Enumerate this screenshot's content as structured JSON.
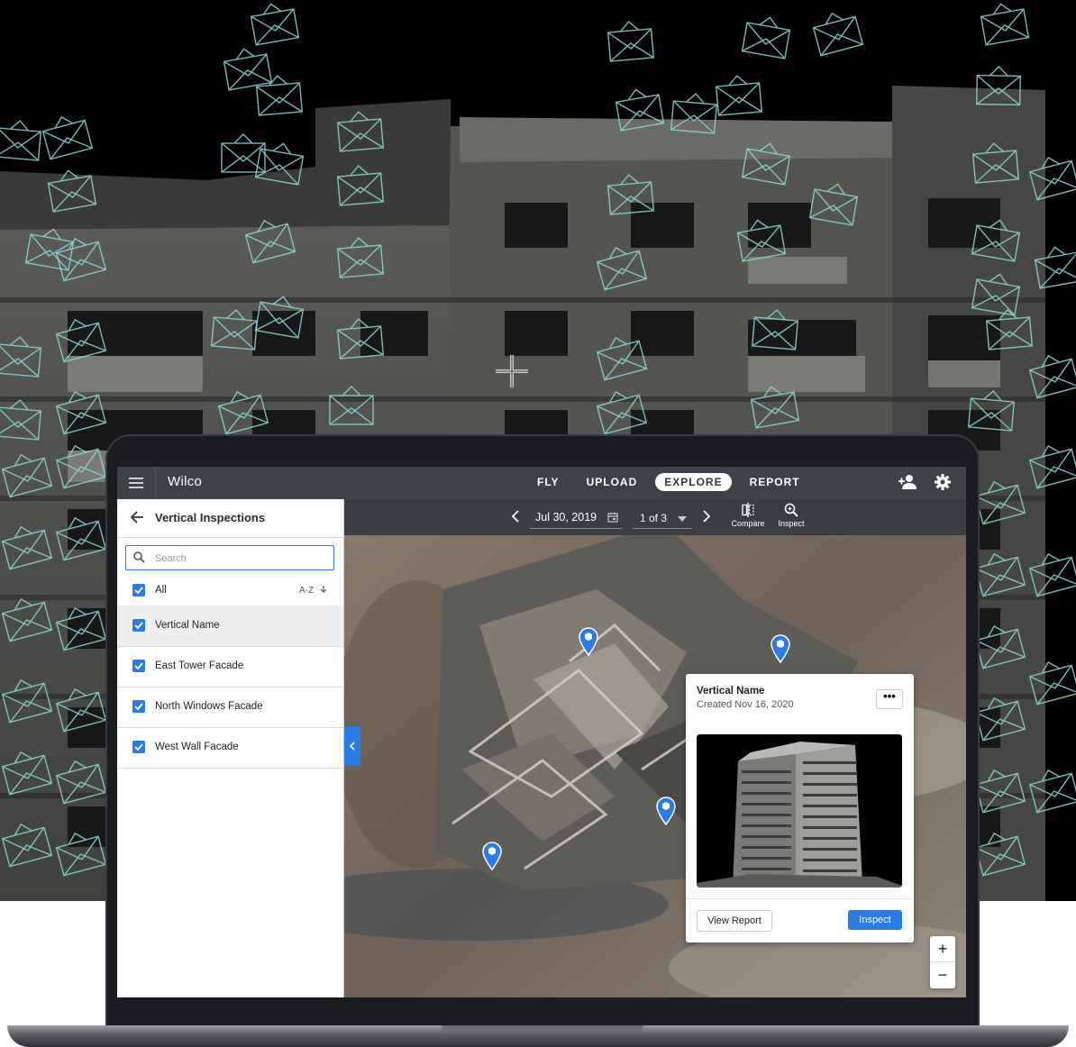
{
  "app": {
    "name": "Wilco"
  },
  "nav": {
    "tabs": [
      "FLY",
      "UPLOAD",
      "EXPLORE",
      "REPORT"
    ],
    "active": "EXPLORE"
  },
  "panel": {
    "title": "Vertical Inspections",
    "search_placeholder": "Search",
    "all_label": "All",
    "sort_label": "A-Z",
    "items": [
      {
        "label": "Vertical Name",
        "checked": true,
        "selected": true
      },
      {
        "label": "East Tower Facade",
        "checked": true,
        "selected": false
      },
      {
        "label": "North Windows Facade",
        "checked": true,
        "selected": false
      },
      {
        "label": "West Wall Facade",
        "checked": true,
        "selected": false
      }
    ]
  },
  "toolbar": {
    "date": "Jul 30, 2019",
    "page": "1 of 3",
    "compare_label": "Compare",
    "inspect_label": "Inspect"
  },
  "card": {
    "title": "Vertical Name",
    "subtitle": "Created Nov 16, 2020",
    "more_label": "•••",
    "view_report_label": "View Report",
    "inspect_label": "Inspect"
  },
  "zoom": {
    "in_label": "+",
    "out_label": "−"
  },
  "icons": [
    "menu-icon",
    "add-user-icon",
    "gear-icon",
    "back-arrow-icon",
    "search-icon",
    "checkbox-check-icon",
    "sort-arrow-icon",
    "chevron-left-icon",
    "chevron-right-icon",
    "calendar-icon",
    "caret-down-icon",
    "compare-icon",
    "inspect-icon",
    "map-pin-icon",
    "crosshair-icon"
  ],
  "colors": {
    "accent": "#2b7be5",
    "topbar": "#3d4247",
    "toolbar": "#393d41",
    "camera_frustum": "#8fd9d6"
  }
}
